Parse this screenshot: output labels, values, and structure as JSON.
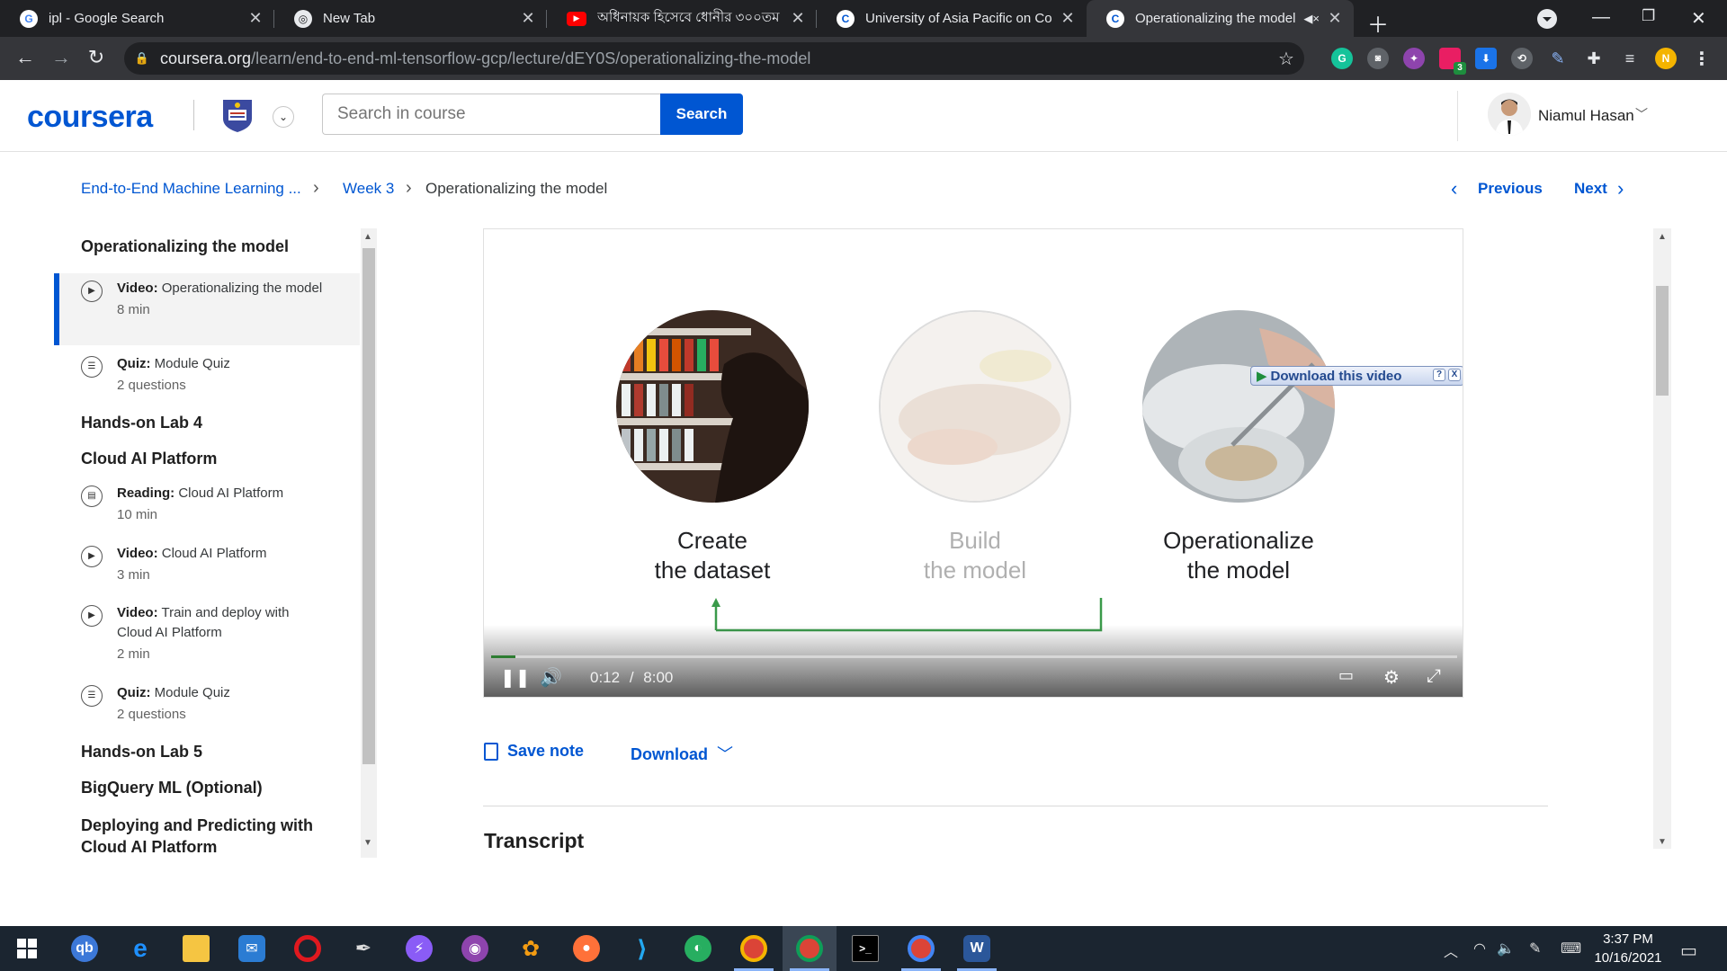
{
  "browser": {
    "tabs": [
      {
        "title": "ipl - Google Search",
        "favicon": "google-icon"
      },
      {
        "title": "New Tab",
        "favicon": "chrome-icon"
      },
      {
        "title": "অধিনায়ক হিসেবে ধোনীর ৩০০তম",
        "favicon": "youtube-icon"
      },
      {
        "title": "University of Asia Pacific on Cour",
        "favicon": "coursera-icon"
      },
      {
        "title": "Operationalizing the model |",
        "favicon": "coursera-icon",
        "active": true,
        "audio": "speaker-muted-icon"
      }
    ],
    "url_host": "coursera.org",
    "url_path": "/learn/end-to-end-ml-tensorflow-gcp/lecture/dEY0S/operationalizing-the-model",
    "extension_badge": "3"
  },
  "header": {
    "logo": "coursera",
    "search_placeholder": "Search in course",
    "search_button": "Search",
    "user_name": "Niamul Hasan"
  },
  "breadcrumb": {
    "course": "End-to-End Machine Learning ...",
    "week": "Week 3",
    "current": "Operationalizing the model",
    "previous": "Previous",
    "next": "Next"
  },
  "sidebar": {
    "sections": [
      {
        "title": "Operationalizing the model"
      },
      {
        "title": "Hands-on Lab 4"
      },
      {
        "title": "Cloud AI Platform"
      },
      {
        "title": "Hands-on Lab 5"
      },
      {
        "title": "BigQuery ML (Optional)"
      },
      {
        "title": "Deploying and Predicting with Cloud AI Platform"
      }
    ],
    "items": [
      {
        "kind": "Video:",
        "name": "Operationalizing the model",
        "meta": "8 min",
        "icon": "play-icon",
        "active": true
      },
      {
        "kind": "Quiz:",
        "name": "Module Quiz",
        "meta": "2 questions",
        "icon": "quiz-icon"
      },
      {
        "kind": "Reading:",
        "name": "Cloud AI Platform",
        "meta": "10 min",
        "icon": "reading-icon"
      },
      {
        "kind": "Video:",
        "name": "Cloud AI Platform",
        "meta": "3 min",
        "icon": "play-icon"
      },
      {
        "kind": "Video:",
        "name": "Train and deploy with Cloud AI Platform",
        "meta": "2 min",
        "icon": "play-icon"
      },
      {
        "kind": "Quiz:",
        "name": "Module Quiz",
        "meta": "2 questions",
        "icon": "quiz-icon"
      }
    ]
  },
  "video": {
    "captions": [
      {
        "line1": "Create",
        "line2": "the dataset"
      },
      {
        "line1": "Build",
        "line2": "the model"
      },
      {
        "line1": "Operationalize",
        "line2": "the model"
      }
    ],
    "download_overlay": "Download this video",
    "current_time": "0:12",
    "time_sep": "/",
    "duration": "8:00",
    "progress_fraction": 0.025
  },
  "actions": {
    "save_note": "Save note",
    "download": "Download"
  },
  "transcript_heading": "Transcript",
  "taskbar": {
    "clock_time": "3:37 PM",
    "clock_date": "10/16/2021"
  },
  "colors": {
    "accent": "#0056d2",
    "progress": "#2e7d32",
    "chrome_bg": "#202124"
  }
}
